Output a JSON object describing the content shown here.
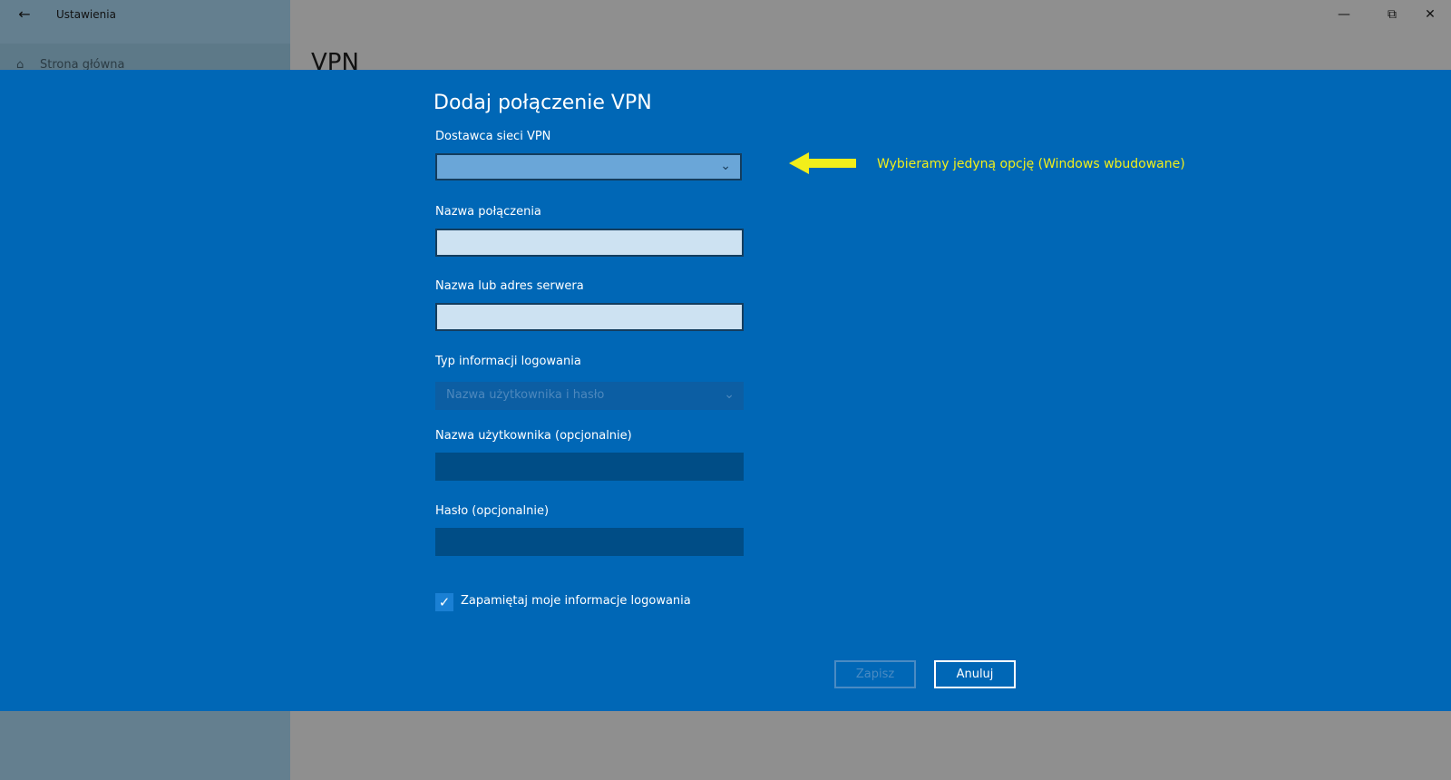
{
  "window": {
    "back_icon": "arrow-left-icon",
    "title": "Ustawienia",
    "minimize_icon": "minimize-icon",
    "restore_icon": "restore-icon",
    "close_icon": "close-icon"
  },
  "sidebar": {
    "home_icon": "home-icon",
    "home_label": "Strona główna"
  },
  "page": {
    "heading": "VPN"
  },
  "dialog": {
    "title": "Dodaj połączenie VPN",
    "fields": {
      "provider_label": "Dostawca sieci VPN",
      "provider_value": "",
      "connection_name_label": "Nazwa połączenia",
      "connection_name_value": "",
      "server_label": "Nazwa lub adres serwera",
      "server_value": "",
      "login_type_label": "Typ informacji logowania",
      "login_type_value": "Nazwa użytkownika i hasło",
      "username_label": "Nazwa użytkownika (opcjonalnie)",
      "username_value": "",
      "password_label": "Hasło (opcjonalnie)",
      "password_value": ""
    },
    "remember": {
      "label": "Zapamiętaj moje informacje logowania",
      "checked": true
    },
    "buttons": {
      "save": "Zapisz",
      "cancel": "Anuluj"
    }
  },
  "annotation": {
    "text": "Wybieramy jedyną opcję (Windows wbudowane)",
    "color": "#f2ee1a"
  },
  "colors": {
    "dialog_bg": "#0067b6",
    "overlay_bg": "#8f8f8f"
  }
}
